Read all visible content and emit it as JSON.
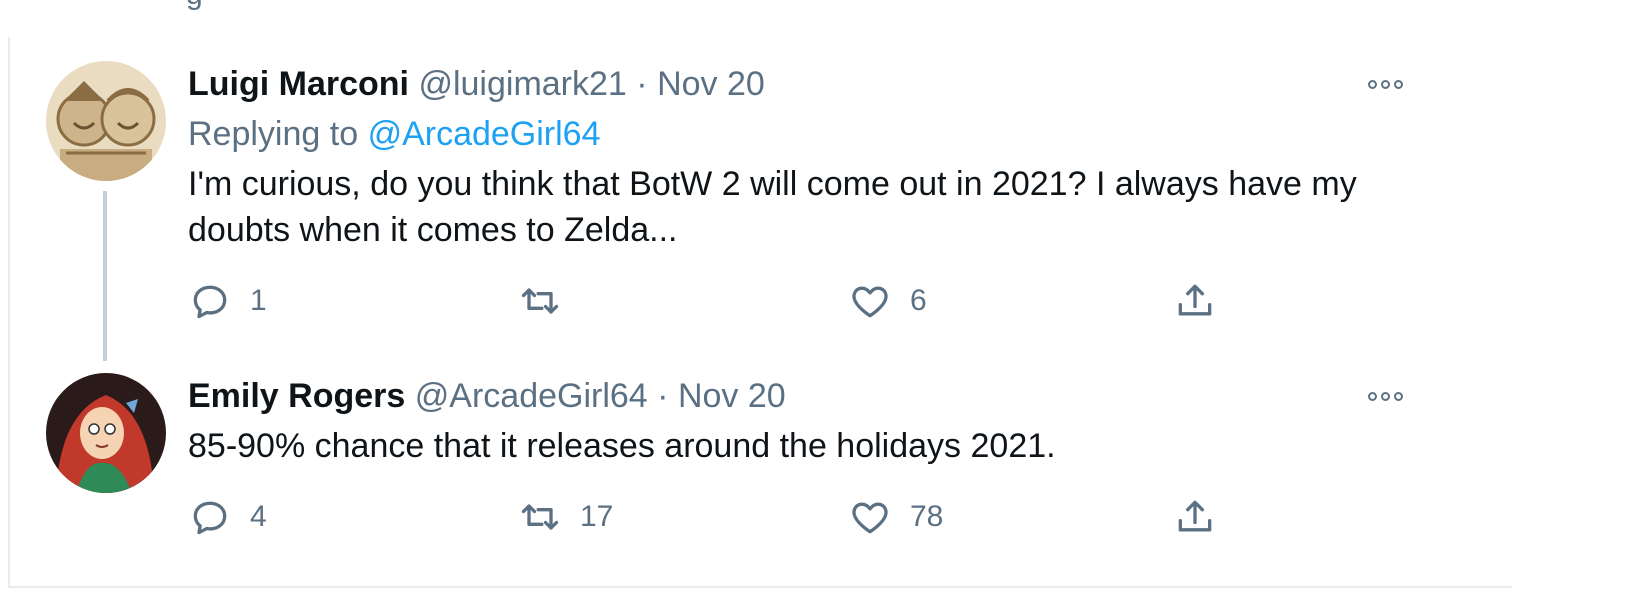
{
  "top_fragment": "g",
  "tweets": [
    {
      "author_name": "Luigi Marconi",
      "handle": "@luigimark21",
      "separator": "·",
      "date": "Nov 20",
      "replying_to_label": "Replying to",
      "replying_to_handle": "@ArcadeGirl64",
      "text": "I'm curious, do you think that BotW 2 will come out in 2021? I always have my doubts when it comes to Zelda...",
      "replies": "1",
      "retweets": "",
      "likes": "6"
    },
    {
      "author_name": "Emily Rogers",
      "handle": "@ArcadeGirl64",
      "separator": "·",
      "date": "Nov 20",
      "text": "85-90% chance that it releases around the holidays 2021.",
      "replies": "4",
      "retweets": "17",
      "likes": "78"
    }
  ],
  "icons": {
    "reply": "reply-icon",
    "retweet": "retweet-icon",
    "like": "heart-icon",
    "share": "share-icon",
    "more": "more-icon"
  },
  "colors": {
    "link": "#1da1f2",
    "muted": "#5b7083",
    "text": "#0f1419",
    "border": "#e6ecf0"
  }
}
